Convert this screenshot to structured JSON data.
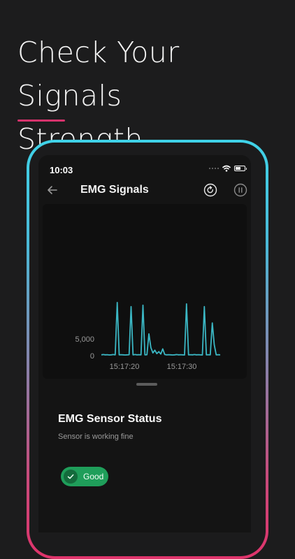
{
  "headline": {
    "line1": "Check Your Signals",
    "line2": "Strength"
  },
  "colors": {
    "accent": "#d6336c",
    "frame_top": "#3fd3e8",
    "frame_bottom": "#e0336b",
    "signal_line": "#3bb7c4",
    "good_green": "#1f9e5a"
  },
  "status_bar": {
    "time": "10:03",
    "icons": [
      "signal-dots-icon",
      "wifi-icon",
      "battery-icon"
    ]
  },
  "app_bar": {
    "title": "EMG Signals",
    "back_icon": "arrow-left-icon",
    "refresh_icon": "refresh-icon",
    "pause_icon": "pause-icon"
  },
  "chart_data": {
    "type": "line",
    "title": "",
    "xlabel": "",
    "ylabel": "",
    "x_ticks": [
      "15:17:20",
      "15:17:30"
    ],
    "y_ticks": [
      "0",
      "5,000"
    ],
    "ylim": [
      0,
      6000
    ],
    "series": [
      {
        "x": [
          0,
          1,
          2,
          3,
          4,
          5,
          6,
          7,
          8,
          9,
          10,
          11,
          12,
          13,
          14,
          15,
          16,
          17,
          18,
          19,
          20,
          21,
          22,
          23,
          24,
          25,
          26,
          27,
          28,
          29,
          30,
          31,
          32,
          33,
          34,
          35,
          36,
          37,
          38,
          39,
          40,
          41,
          42,
          43,
          44,
          45,
          46,
          47,
          48,
          49,
          50,
          51,
          52,
          53,
          54,
          55,
          56,
          57,
          58,
          59,
          60
        ],
        "y": [
          60,
          80,
          60,
          70,
          50,
          60,
          80,
          60,
          3900,
          60,
          70,
          60,
          50,
          60,
          70,
          3600,
          60,
          80,
          60,
          70,
          60,
          3700,
          60,
          70,
          1600,
          600,
          200,
          400,
          150,
          300,
          120,
          500,
          80,
          60,
          70,
          60,
          50,
          60,
          80,
          60,
          70,
          60,
          50,
          3800,
          60,
          70,
          60,
          80,
          60,
          70,
          60,
          50,
          3600,
          60,
          70,
          60,
          2400,
          800,
          60,
          70,
          60
        ]
      }
    ]
  },
  "status": {
    "title": "EMG Sensor Status",
    "subtitle": "Sensor is working fine",
    "badge_label": "Good",
    "badge_icon": "check-icon"
  }
}
